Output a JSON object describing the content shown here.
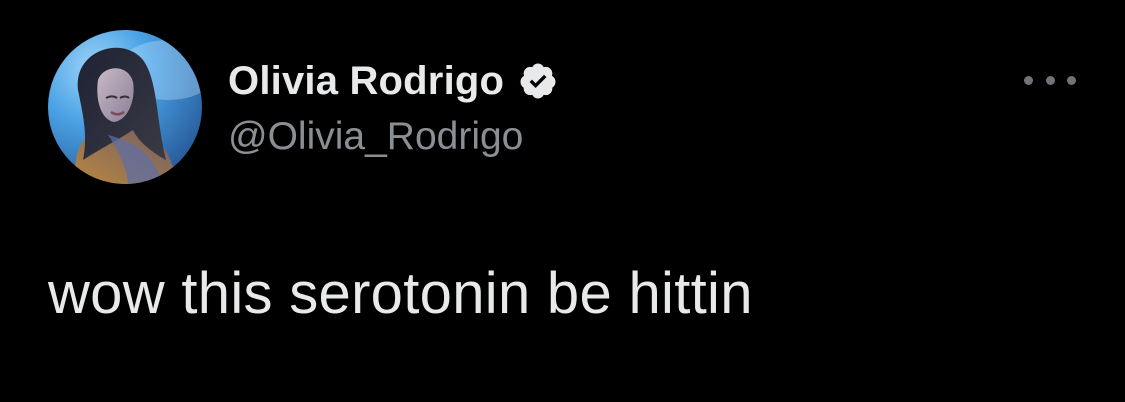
{
  "author": {
    "display_name": "Olivia Rodrigo",
    "handle": "@Olivia_Rodrigo",
    "verified": true,
    "avatar_icon": "profile-photo"
  },
  "tweet": {
    "text": "wow this serotonin be hittin"
  },
  "icons": {
    "verified_badge": "verified-badge-icon",
    "more_options": "more-options-icon"
  },
  "colors": {
    "background": "#000000",
    "primary_text": "#e7e9ea",
    "secondary_text": "#8b8f94"
  }
}
